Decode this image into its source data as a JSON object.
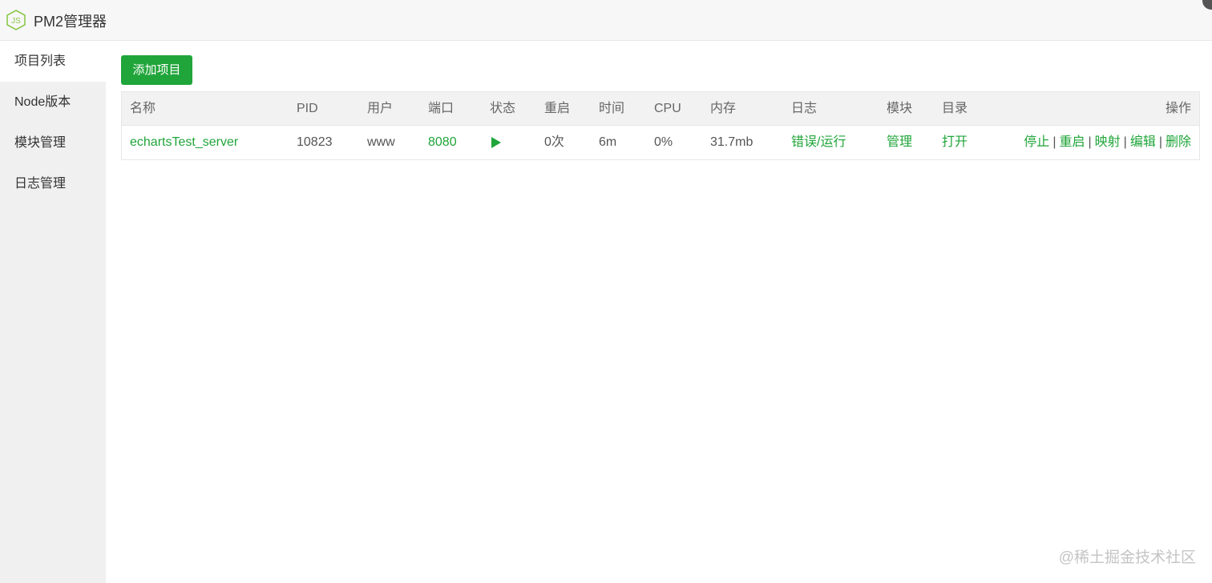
{
  "app": {
    "title": "PM2管理器",
    "logo_icon": "nodejs-hexagon-icon",
    "accent": "#20a53a"
  },
  "sidebar": {
    "items": [
      {
        "label": "项目列表",
        "active": true
      },
      {
        "label": "Node版本",
        "active": false
      },
      {
        "label": "模块管理",
        "active": false
      },
      {
        "label": "日志管理",
        "active": false
      }
    ]
  },
  "toolbar": {
    "add_label": "添加项目"
  },
  "table": {
    "headers": {
      "name": "名称",
      "pid": "PID",
      "user": "用户",
      "port": "端口",
      "status": "状态",
      "restart": "重启",
      "time": "时间",
      "cpu": "CPU",
      "memory": "内存",
      "log": "日志",
      "module": "模块",
      "dir": "目录",
      "actions": "操作"
    },
    "rows": [
      {
        "name": "echartsTest_server",
        "pid": "10823",
        "user": "www",
        "port": "8080",
        "status_icon": "play-icon",
        "restart": "0次",
        "time": "6m",
        "cpu": "0%",
        "memory": "31.7mb",
        "log_error": "错误",
        "log_sep": "/",
        "log_run": "运行",
        "module": "管理",
        "dir": "打开",
        "actions": [
          "停止",
          "重启",
          "映射",
          "编辑",
          "删除"
        ],
        "action_sep": "|"
      }
    ]
  },
  "watermark": "@稀土掘金技术社区"
}
